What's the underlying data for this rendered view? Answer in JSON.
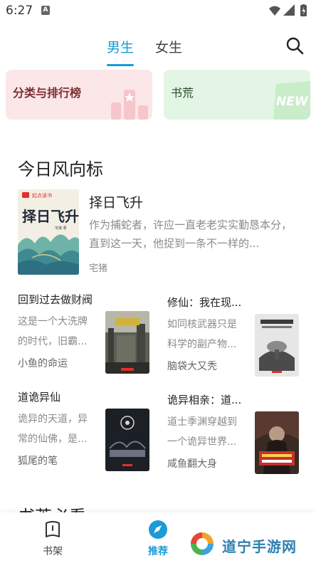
{
  "status_bar": {
    "time": "6:27",
    "notification_letter": "A",
    "icons": [
      "wifi-icon",
      "signal-icon",
      "battery-icon"
    ]
  },
  "top_tabs": {
    "tabs": [
      {
        "label": "男生",
        "active": true
      },
      {
        "label": "女生",
        "active": false
      }
    ],
    "search_icon": "search-icon",
    "accent_color": "#1a9bd7"
  },
  "banners": [
    {
      "label": "分类与排行榜",
      "bg_color": "#fbe6e8"
    },
    {
      "label": "书荒",
      "badge": "NEW",
      "bg_color": "#e3f5e4"
    }
  ],
  "section": {
    "title": "今日风向标",
    "next_title": "书荒必看"
  },
  "featured_book": {
    "title": "择日飞升",
    "description": "作为捕蛇者，许应一直老老实实勤恳本分，直到这一天，他捉到一条不一样的...",
    "author": "宅猪",
    "cover_text": "择日飞升",
    "cover_badge": "起点读书",
    "cover_author": "宅猪 著"
  },
  "grid_books": [
    {
      "title": "回到过去做财阀",
      "description": "这是一个大洗牌的时代，旧霸...",
      "author": "小鱼的命运"
    },
    {
      "title": "修仙：我在现...",
      "description": "如同核武器只是科学的副产物...",
      "author": "脑袋大又秃"
    },
    {
      "title": "道诡异仙",
      "description": "诡异的天道，异常的仙佛，是...",
      "author": "狐尾的笔"
    },
    {
      "title": "诡异相亲：道...",
      "description": "道士季渊穿越到一个诡异世界...",
      "author": "咸鱼翻大身"
    }
  ],
  "bottom_nav": {
    "items": [
      {
        "label": "书架",
        "icon": "bookshelf-icon",
        "active": false
      },
      {
        "label": "推荐",
        "icon": "compass-icon",
        "active": true
      }
    ]
  },
  "watermark": {
    "text": "道宁手游网"
  }
}
